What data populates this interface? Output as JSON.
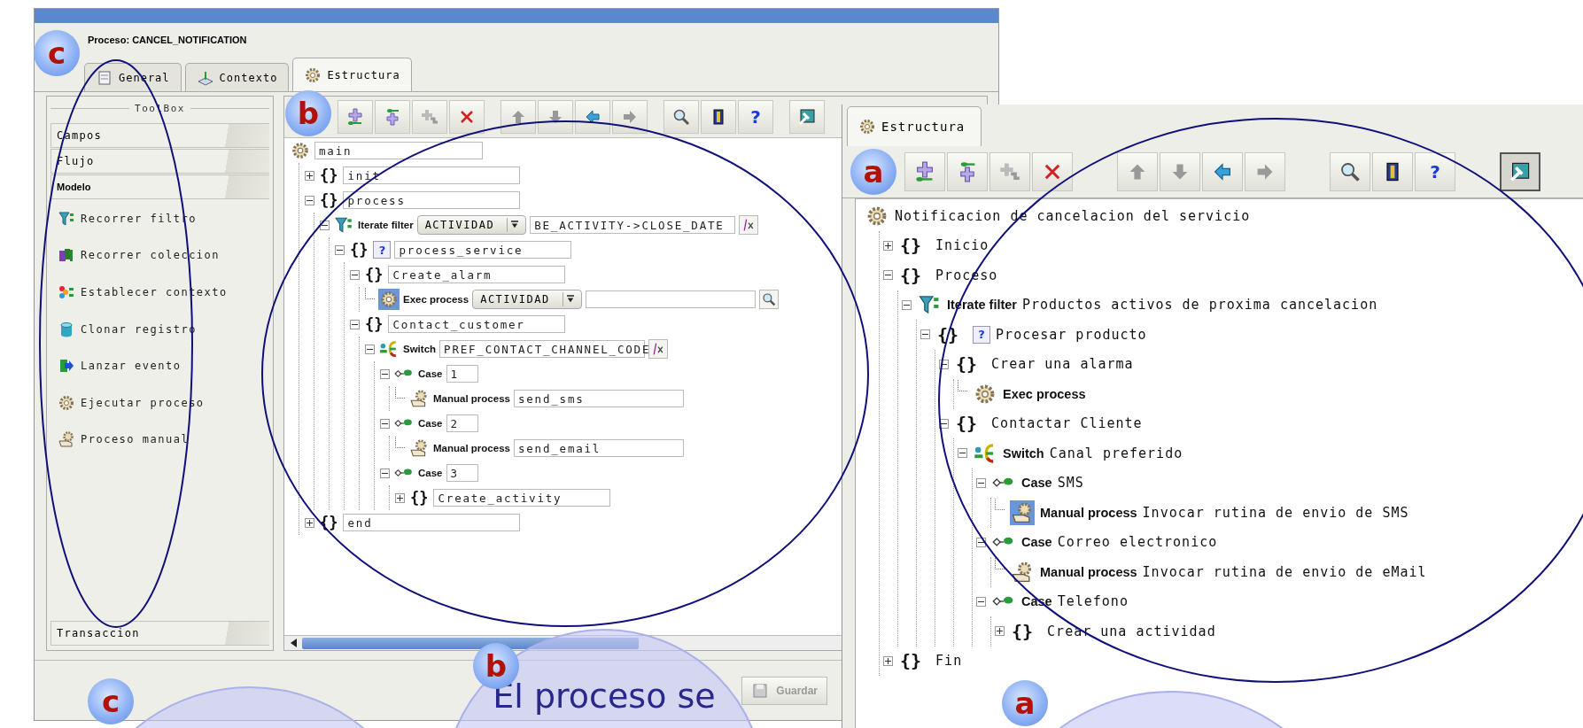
{
  "left_window": {
    "title": "Proceso: CANCEL_NOTIFICATION",
    "tabs": [
      {
        "label": "General",
        "selected": false
      },
      {
        "label": "Contexto",
        "selected": false
      },
      {
        "label": "Estructura",
        "selected": true
      }
    ],
    "toolbox": {
      "title": "ToolBox",
      "sections": [
        {
          "label": "Campos",
          "selected": false
        },
        {
          "label": "Flujo",
          "selected": false
        },
        {
          "label": "Modelo",
          "selected": true,
          "items": [
            {
              "kind": "filter",
              "label": "Recorrer filtro"
            },
            {
              "kind": "collection",
              "label": "Recorrer coleccion"
            },
            {
              "kind": "context",
              "label": "Establecer contexto"
            },
            {
              "kind": "clone",
              "label": "Clonar registro"
            },
            {
              "kind": "event",
              "label": "Lanzar evento"
            },
            {
              "kind": "gear",
              "label": "Ejecutar proceso"
            },
            {
              "kind": "manual",
              "label": "Proceso manual"
            }
          ]
        },
        {
          "label": "Transaccion",
          "selected": false
        }
      ]
    },
    "toolbar": [
      [
        {
          "kind": "add_sibling"
        },
        {
          "kind": "add_child"
        },
        {
          "kind": "add_branch"
        },
        {
          "kind": "delete"
        }
      ],
      [
        {
          "kind": "up"
        },
        {
          "kind": "down"
        },
        {
          "kind": "left"
        },
        {
          "kind": "right"
        }
      ],
      [
        {
          "kind": "search"
        },
        {
          "kind": "book"
        },
        {
          "kind": "help",
          "text": "?"
        }
      ],
      [
        {
          "kind": "toggle",
          "pressed": false
        }
      ]
    ],
    "tree": {
      "kind": "root",
      "value": "main",
      "selected": false,
      "children": [
        {
          "kind": "block",
          "icon_text": "{}",
          "value": "init",
          "expanded": false,
          "selected": false
        },
        {
          "kind": "block",
          "icon_text": "{}",
          "value": "process",
          "expanded": true,
          "selected": false,
          "children": [
            {
              "kind": "iterate_filter",
              "label": "Iterate filter",
              "entity": "ACTIVIDAD",
              "value": "BE_ACTIVITY->CLOSE_DATE",
              "expanded": true,
              "selected": false,
              "children": [
                {
                  "kind": "block",
                  "icon_text": "{}",
                  "badge": "?",
                  "value": "process_service",
                  "expanded": true,
                  "selected": false,
                  "children": [
                    {
                      "kind": "block",
                      "icon_text": "{}",
                      "value": "Create_alarm",
                      "expanded": true,
                      "selected": false,
                      "children": [
                        {
                          "kind": "exec_process",
                          "label": "Exec process",
                          "entity": "ACTIVIDAD",
                          "selected": true
                        }
                      ]
                    },
                    {
                      "kind": "block",
                      "icon_text": "{}",
                      "value": "Contact_customer",
                      "expanded": true,
                      "selected": false,
                      "children": [
                        {
                          "kind": "switch",
                          "label": "Switch",
                          "value": "PREF_CONTACT_CHANNEL_CODE",
                          "expanded": true,
                          "selected": false,
                          "children": [
                            {
                              "kind": "case",
                              "label": "Case",
                              "value": "1",
                              "expanded": true,
                              "selected": false,
                              "children": [
                                {
                                  "kind": "manual_process",
                                  "label": "Manual process",
                                  "value": "send_sms",
                                  "selected": false
                                }
                              ]
                            },
                            {
                              "kind": "case",
                              "label": "Case",
                              "value": "2",
                              "expanded": true,
                              "selected": false,
                              "children": [
                                {
                                  "kind": "manual_process",
                                  "label": "Manual process",
                                  "value": "send_email",
                                  "selected": false
                                }
                              ]
                            },
                            {
                              "kind": "case",
                              "label": "Case",
                              "value": "3",
                              "expanded": true,
                              "selected": false,
                              "children": [
                                {
                                  "kind": "block",
                                  "icon_text": "{}",
                                  "value": "Create_activity",
                                  "expanded": false,
                                  "selected": false
                                }
                              ]
                            }
                          ]
                        }
                      ]
                    }
                  ]
                }
              ]
            }
          ]
        },
        {
          "kind": "block",
          "icon_text": "{}",
          "value": "end",
          "expanded": false,
          "selected": false
        }
      ]
    },
    "save_button": "Guardar"
  },
  "right_panel": {
    "tabs": [
      {
        "label": "Estructura",
        "selected": true
      }
    ],
    "toolbar": [
      [
        {
          "kind": "add_sibling"
        },
        {
          "kind": "add_child"
        },
        {
          "kind": "add_branch"
        },
        {
          "kind": "delete"
        }
      ],
      [
        {
          "kind": "up"
        },
        {
          "kind": "down"
        },
        {
          "kind": "left"
        },
        {
          "kind": "right"
        }
      ],
      [
        {
          "kind": "search"
        },
        {
          "kind": "book"
        },
        {
          "kind": "help",
          "text": "?"
        }
      ],
      [
        {
          "kind": "toggle",
          "pressed": true
        }
      ]
    ],
    "tree": {
      "kind": "root",
      "value": "Notificacion de cancelacion del servicio",
      "selected": false,
      "children": [
        {
          "kind": "block",
          "icon_text": "{}",
          "value": "Inicio",
          "expanded": false,
          "selected": false
        },
        {
          "kind": "block",
          "icon_text": "{}",
          "value": "Proceso",
          "expanded": true,
          "selected": false,
          "children": [
            {
              "kind": "iterate_filter",
              "label": "Iterate filter",
              "value": "Productos activos de proxima cancelacion",
              "expanded": true,
              "selected": false,
              "children": [
                {
                  "kind": "block",
                  "icon_text": "{}",
                  "badge": "?",
                  "value": "Procesar producto",
                  "expanded": true,
                  "selected": false,
                  "children": [
                    {
                      "kind": "block",
                      "icon_text": "{}",
                      "value": "Crear una alarma",
                      "expanded": true,
                      "selected": false,
                      "children": [
                        {
                          "kind": "exec_process",
                          "label": "Exec process",
                          "selected": false
                        }
                      ]
                    },
                    {
                      "kind": "block",
                      "icon_text": "{}",
                      "value": "Contactar Cliente",
                      "expanded": true,
                      "selected": false,
                      "children": [
                        {
                          "kind": "switch",
                          "label": "Switch",
                          "value": "Canal preferido",
                          "expanded": true,
                          "selected": false,
                          "children": [
                            {
                              "kind": "case",
                              "label": "Case",
                              "value": "SMS",
                              "expanded": true,
                              "selected": false,
                              "children": [
                                {
                                  "kind": "manual_process",
                                  "label": "Manual process",
                                  "value": "Invocar rutina de envio de SMS",
                                  "selected": true
                                }
                              ]
                            },
                            {
                              "kind": "case",
                              "label": "Case",
                              "value": "Correo electronico",
                              "expanded": true,
                              "selected": false,
                              "children": [
                                {
                                  "kind": "manual_process",
                                  "label": "Manual process",
                                  "value": "Invocar rutina de envio de eMail",
                                  "selected": false
                                }
                              ]
                            },
                            {
                              "kind": "case",
                              "label": "Case",
                              "value": "Telefono",
                              "expanded": true,
                              "selected": false,
                              "children": [
                                {
                                  "kind": "block",
                                  "icon_text": "{}",
                                  "value": "Crear una actividad",
                                  "expanded": false,
                                  "selected": false
                                }
                              ]
                            }
                          ]
                        }
                      ]
                    }
                  ]
                }
              ]
            }
          ]
        },
        {
          "kind": "block",
          "icon_text": "{}",
          "value": "Fin",
          "expanded": false,
          "selected": false
        }
      ]
    }
  },
  "annotations": {
    "badges": [
      {
        "label": "c"
      },
      {
        "label": "b"
      },
      {
        "label": "a"
      },
      {
        "label": "b"
      },
      {
        "label": "c"
      },
      {
        "label": "a"
      }
    ],
    "callout": {
      "text": "El proceso se"
    }
  }
}
